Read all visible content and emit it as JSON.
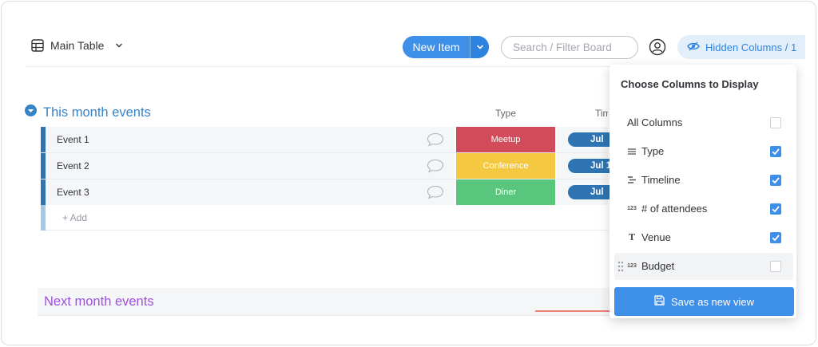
{
  "toolbar": {
    "view_label": "Main Table",
    "new_item_label": "New Item",
    "search_placeholder": "Search / Filter Board",
    "hidden_columns_label": "Hidden Columns / 1"
  },
  "group1": {
    "title": "This month events",
    "color": "#3584c8",
    "columns": [
      "Type",
      "Timeline"
    ],
    "rows": [
      {
        "name": "Event 1",
        "type": "Meetup",
        "type_color": "#d14b5a",
        "timeline": "Jul"
      },
      {
        "name": "Event 2",
        "type": "Conference",
        "type_color": "#f5c842",
        "timeline": "Jul 1"
      },
      {
        "name": "Event 3",
        "type": "Diner",
        "type_color": "#58c67c",
        "timeline": "Jul"
      }
    ],
    "add_label": "+ Add"
  },
  "group2": {
    "title": "Next month events",
    "color": "#9d50dd"
  },
  "popover": {
    "title": "Choose Columns to Display",
    "options": [
      {
        "label": "All Columns",
        "icon": "",
        "checked": false
      },
      {
        "label": "Type",
        "icon": "status-lines-icon",
        "checked": true
      },
      {
        "label": "Timeline",
        "icon": "timeline-icon",
        "checked": true
      },
      {
        "label": "# of attendees",
        "icon": "numbers-icon",
        "checked": true
      },
      {
        "label": "Venue",
        "icon": "text-icon",
        "checked": true
      },
      {
        "label": "Budget",
        "icon": "numbers-icon",
        "checked": false
      }
    ],
    "numbers_glyph": "123",
    "text_glyph": "T",
    "save_label": "Save as new view"
  },
  "colors": {
    "accent": "#3d8fe8",
    "annotation_arrow": "#e8392b"
  }
}
